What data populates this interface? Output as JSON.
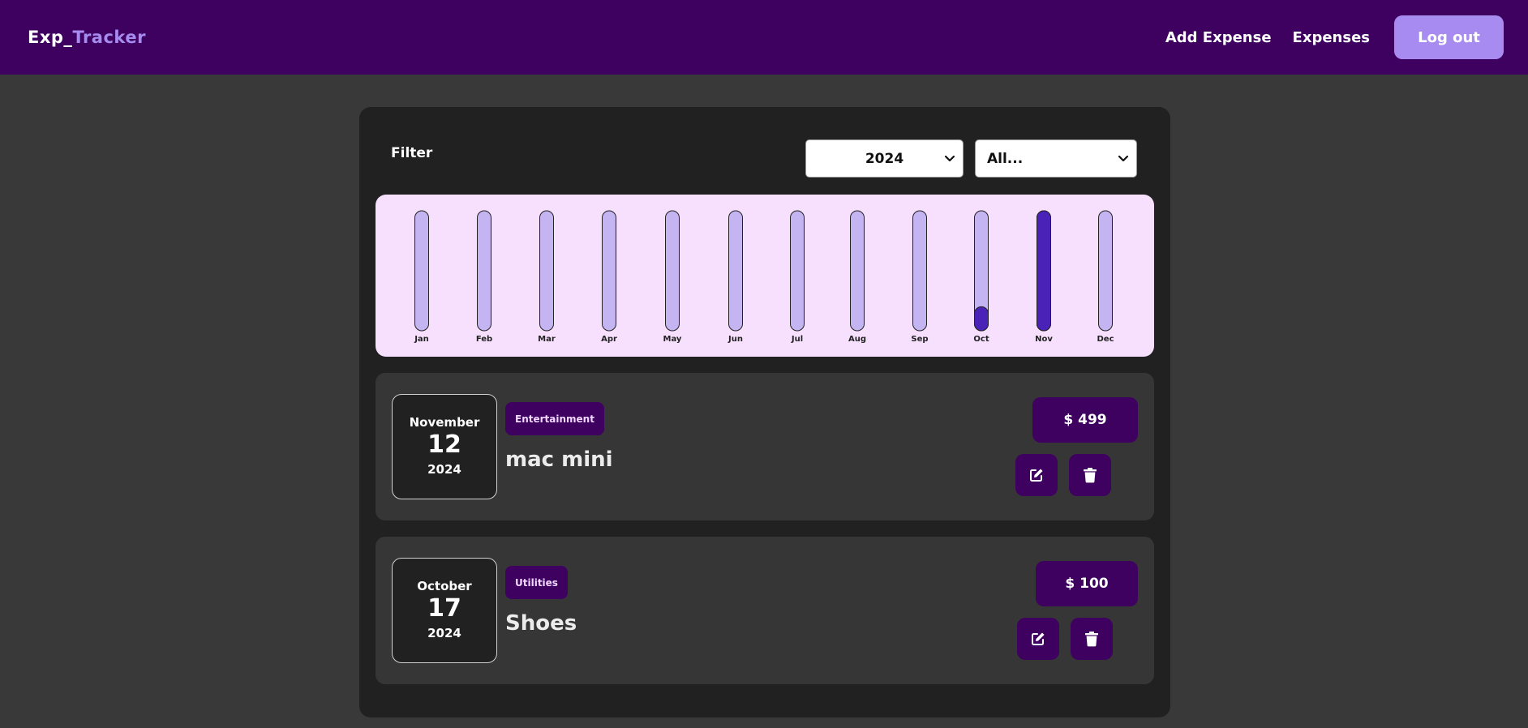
{
  "navbar": {
    "brand_prefix": "Exp_",
    "brand_suffix": "Tracker",
    "links": [
      "Add Expense",
      "Expenses"
    ],
    "logout_label": "Log out"
  },
  "filter": {
    "label": "Filter",
    "year_value": "2024",
    "category_value": "All..."
  },
  "chart_data": {
    "type": "bar",
    "categories": [
      "Jan",
      "Feb",
      "Mar",
      "Apr",
      "May",
      "Jun",
      "Jul",
      "Aug",
      "Sep",
      "Oct",
      "Nov",
      "Dec"
    ],
    "values": [
      0,
      0,
      0,
      0,
      0,
      0,
      0,
      0,
      0,
      100,
      499,
      0
    ],
    "ylim": [
      0,
      499
    ],
    "colors": {
      "track": "#c4b4f2",
      "fill": "#4a22b8",
      "background": "#f7dffe",
      "stroke": "#222222"
    }
  },
  "expenses": [
    {
      "month": "November",
      "day": "12",
      "year": "2024",
      "category": "Entertainment",
      "title": "mac mini",
      "amount": "$ 499"
    },
    {
      "month": "October",
      "day": "17",
      "year": "2024",
      "category": "Utilities",
      "title": "Shoes",
      "amount": "$ 100"
    }
  ],
  "colors": {
    "navbar": "#3f0160",
    "accent": "#a88bf0",
    "panel": "#212121",
    "card": "#373637",
    "page": "#3a393a"
  },
  "icons": {
    "edit": "edit-icon",
    "delete": "trash-icon",
    "dropdown": "chevron-down-icon"
  }
}
